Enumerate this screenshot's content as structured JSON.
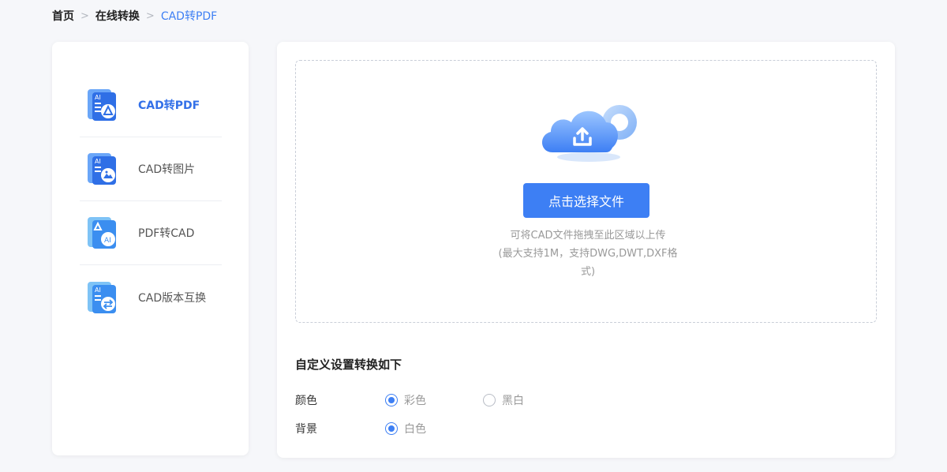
{
  "breadcrumb": {
    "home": "首页",
    "online": "在线转换",
    "current": "CAD转PDF",
    "separator": ">"
  },
  "sidebar": {
    "items": [
      {
        "label": "CAD转PDF",
        "icon": "cad-to-pdf-icon",
        "active": true
      },
      {
        "label": "CAD转图片",
        "icon": "cad-to-image-icon",
        "active": false
      },
      {
        "label": "PDF转CAD",
        "icon": "pdf-to-cad-icon",
        "active": false
      },
      {
        "label": "CAD版本互换",
        "icon": "cad-version-swap-icon",
        "active": false
      }
    ]
  },
  "upload": {
    "button_label": "点击选择文件",
    "hint_line1": "可将CAD文件拖拽至此区域以上传",
    "hint_line2": "(最大支持1M，支持DWG,DWT,DXF格",
    "hint_line3": "式)",
    "icon": "cloud-upload-icon"
  },
  "settings": {
    "title": "自定义设置转换如下",
    "color": {
      "label": "颜色",
      "options": [
        {
          "label": "彩色",
          "checked": true
        },
        {
          "label": "黑白",
          "checked": false
        }
      ]
    },
    "background": {
      "label": "背景",
      "options": [
        {
          "label": "白色",
          "checked": true
        }
      ]
    }
  },
  "colors": {
    "accent": "#3d7ff4",
    "active_text": "#3370e8",
    "page_bg": "#f6f7fa"
  }
}
